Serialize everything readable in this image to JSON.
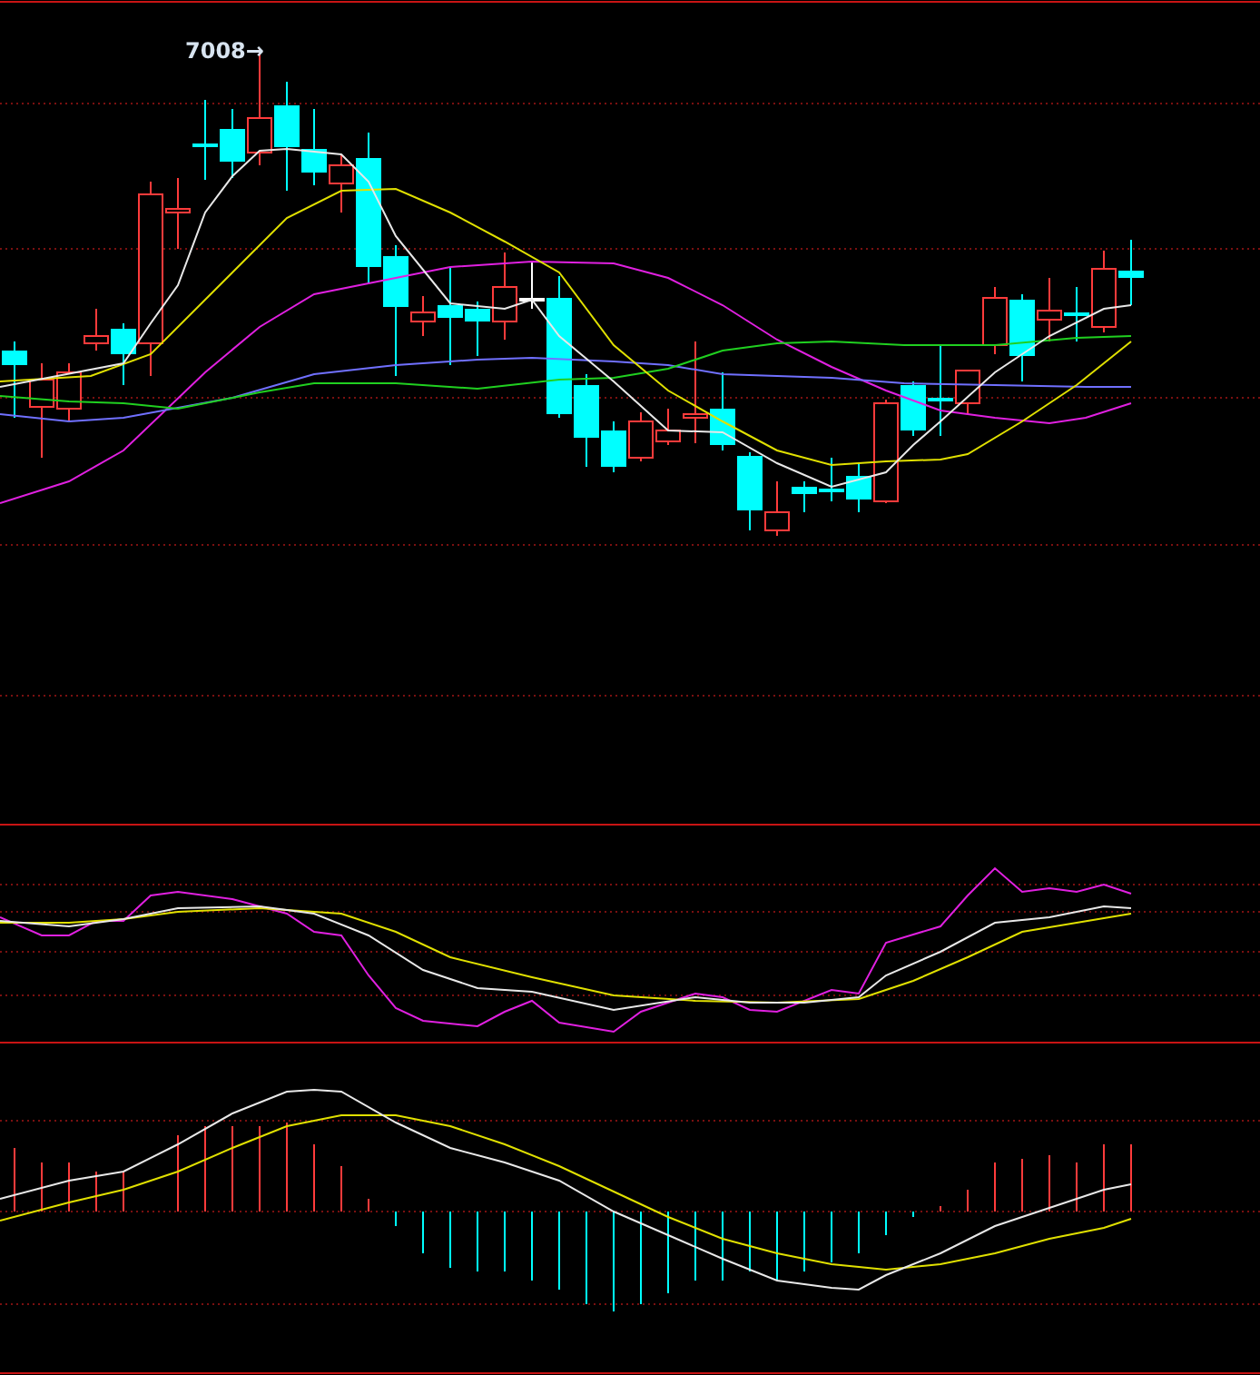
{
  "price_chart": {
    "high_label": "7008→"
  }
}
